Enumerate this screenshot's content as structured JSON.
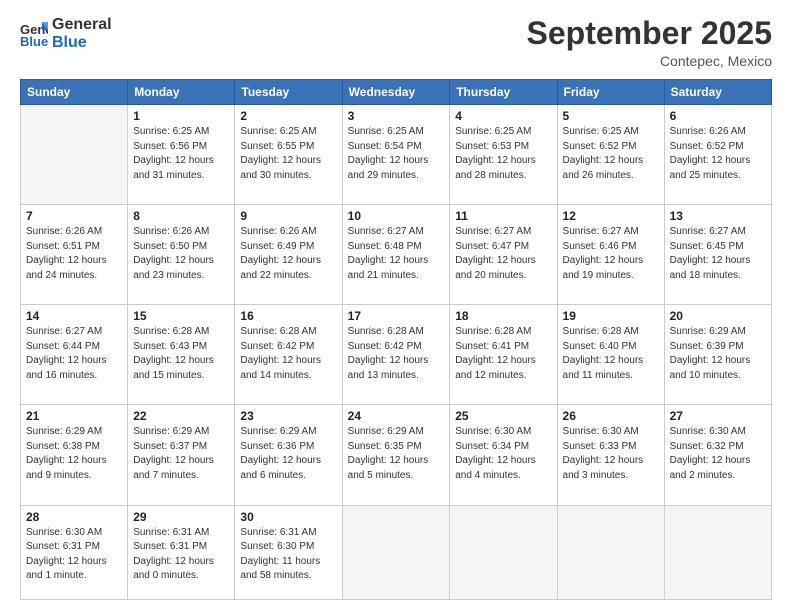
{
  "header": {
    "logo_general": "General",
    "logo_blue": "Blue",
    "month": "September 2025",
    "location": "Contepec, Mexico"
  },
  "weekdays": [
    "Sunday",
    "Monday",
    "Tuesday",
    "Wednesday",
    "Thursday",
    "Friday",
    "Saturday"
  ],
  "weeks": [
    [
      {
        "day": "",
        "info": ""
      },
      {
        "day": "1",
        "info": "Sunrise: 6:25 AM\nSunset: 6:56 PM\nDaylight: 12 hours\nand 31 minutes."
      },
      {
        "day": "2",
        "info": "Sunrise: 6:25 AM\nSunset: 6:55 PM\nDaylight: 12 hours\nand 30 minutes."
      },
      {
        "day": "3",
        "info": "Sunrise: 6:25 AM\nSunset: 6:54 PM\nDaylight: 12 hours\nand 29 minutes."
      },
      {
        "day": "4",
        "info": "Sunrise: 6:25 AM\nSunset: 6:53 PM\nDaylight: 12 hours\nand 28 minutes."
      },
      {
        "day": "5",
        "info": "Sunrise: 6:25 AM\nSunset: 6:52 PM\nDaylight: 12 hours\nand 26 minutes."
      },
      {
        "day": "6",
        "info": "Sunrise: 6:26 AM\nSunset: 6:52 PM\nDaylight: 12 hours\nand 25 minutes."
      }
    ],
    [
      {
        "day": "7",
        "info": "Sunrise: 6:26 AM\nSunset: 6:51 PM\nDaylight: 12 hours\nand 24 minutes."
      },
      {
        "day": "8",
        "info": "Sunrise: 6:26 AM\nSunset: 6:50 PM\nDaylight: 12 hours\nand 23 minutes."
      },
      {
        "day": "9",
        "info": "Sunrise: 6:26 AM\nSunset: 6:49 PM\nDaylight: 12 hours\nand 22 minutes."
      },
      {
        "day": "10",
        "info": "Sunrise: 6:27 AM\nSunset: 6:48 PM\nDaylight: 12 hours\nand 21 minutes."
      },
      {
        "day": "11",
        "info": "Sunrise: 6:27 AM\nSunset: 6:47 PM\nDaylight: 12 hours\nand 20 minutes."
      },
      {
        "day": "12",
        "info": "Sunrise: 6:27 AM\nSunset: 6:46 PM\nDaylight: 12 hours\nand 19 minutes."
      },
      {
        "day": "13",
        "info": "Sunrise: 6:27 AM\nSunset: 6:45 PM\nDaylight: 12 hours\nand 18 minutes."
      }
    ],
    [
      {
        "day": "14",
        "info": "Sunrise: 6:27 AM\nSunset: 6:44 PM\nDaylight: 12 hours\nand 16 minutes."
      },
      {
        "day": "15",
        "info": "Sunrise: 6:28 AM\nSunset: 6:43 PM\nDaylight: 12 hours\nand 15 minutes."
      },
      {
        "day": "16",
        "info": "Sunrise: 6:28 AM\nSunset: 6:42 PM\nDaylight: 12 hours\nand 14 minutes."
      },
      {
        "day": "17",
        "info": "Sunrise: 6:28 AM\nSunset: 6:42 PM\nDaylight: 12 hours\nand 13 minutes."
      },
      {
        "day": "18",
        "info": "Sunrise: 6:28 AM\nSunset: 6:41 PM\nDaylight: 12 hours\nand 12 minutes."
      },
      {
        "day": "19",
        "info": "Sunrise: 6:28 AM\nSunset: 6:40 PM\nDaylight: 12 hours\nand 11 minutes."
      },
      {
        "day": "20",
        "info": "Sunrise: 6:29 AM\nSunset: 6:39 PM\nDaylight: 12 hours\nand 10 minutes."
      }
    ],
    [
      {
        "day": "21",
        "info": "Sunrise: 6:29 AM\nSunset: 6:38 PM\nDaylight: 12 hours\nand 9 minutes."
      },
      {
        "day": "22",
        "info": "Sunrise: 6:29 AM\nSunset: 6:37 PM\nDaylight: 12 hours\nand 7 minutes."
      },
      {
        "day": "23",
        "info": "Sunrise: 6:29 AM\nSunset: 6:36 PM\nDaylight: 12 hours\nand 6 minutes."
      },
      {
        "day": "24",
        "info": "Sunrise: 6:29 AM\nSunset: 6:35 PM\nDaylight: 12 hours\nand 5 minutes."
      },
      {
        "day": "25",
        "info": "Sunrise: 6:30 AM\nSunset: 6:34 PM\nDaylight: 12 hours\nand 4 minutes."
      },
      {
        "day": "26",
        "info": "Sunrise: 6:30 AM\nSunset: 6:33 PM\nDaylight: 12 hours\nand 3 minutes."
      },
      {
        "day": "27",
        "info": "Sunrise: 6:30 AM\nSunset: 6:32 PM\nDaylight: 12 hours\nand 2 minutes."
      }
    ],
    [
      {
        "day": "28",
        "info": "Sunrise: 6:30 AM\nSunset: 6:31 PM\nDaylight: 12 hours\nand 1 minute."
      },
      {
        "day": "29",
        "info": "Sunrise: 6:31 AM\nSunset: 6:31 PM\nDaylight: 12 hours\nand 0 minutes."
      },
      {
        "day": "30",
        "info": "Sunrise: 6:31 AM\nSunset: 6:30 PM\nDaylight: 11 hours\nand 58 minutes."
      },
      {
        "day": "",
        "info": ""
      },
      {
        "day": "",
        "info": ""
      },
      {
        "day": "",
        "info": ""
      },
      {
        "day": "",
        "info": ""
      }
    ]
  ]
}
